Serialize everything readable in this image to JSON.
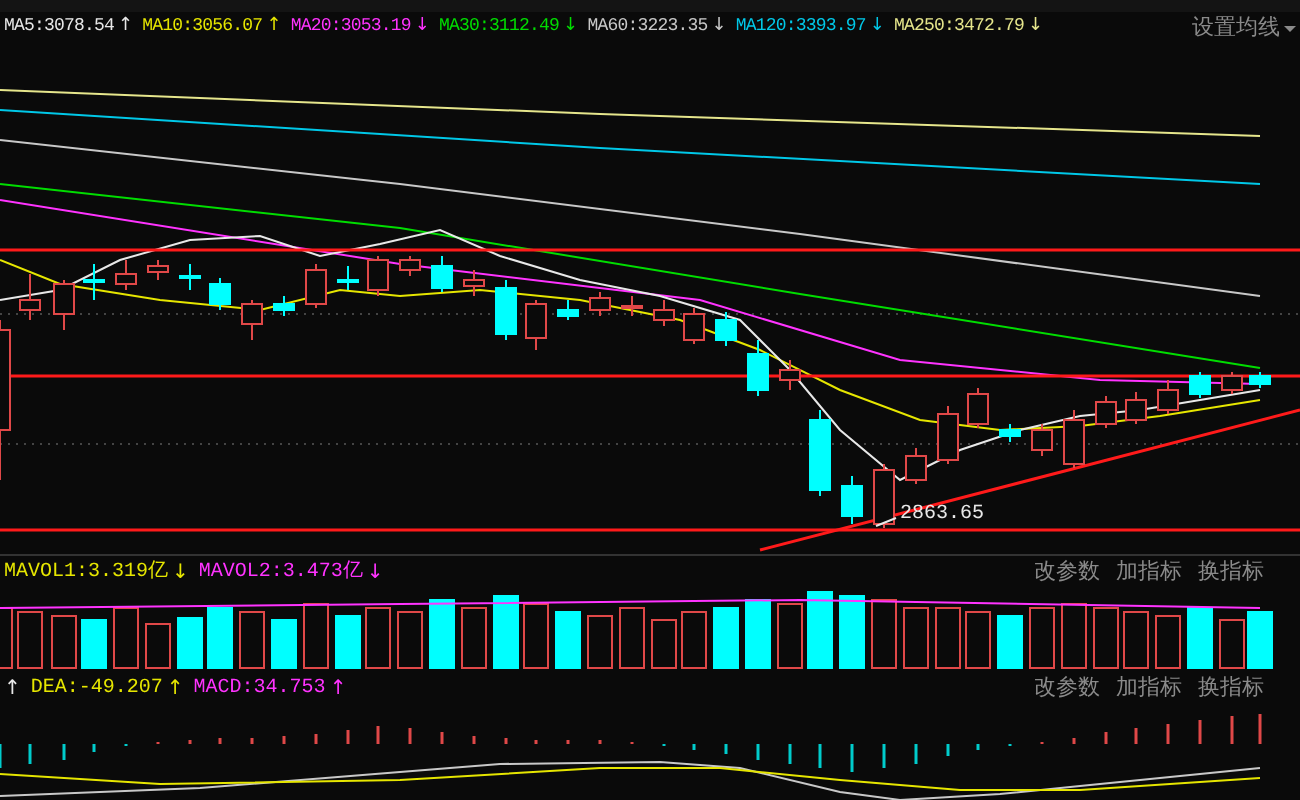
{
  "ma_legend": [
    {
      "label": "MA5:3078.54",
      "color": "#e8e8e8",
      "arrow": "↑"
    },
    {
      "label": "MA10:3056.07",
      "color": "#e6e600",
      "arrow": "↑"
    },
    {
      "label": "MA20:3053.19",
      "color": "#ff33ff",
      "arrow": "↓"
    },
    {
      "label": "MA30:3112.49",
      "color": "#00dd00",
      "arrow": "↓"
    },
    {
      "label": "MA60:3223.35",
      "color": "#c8c8c8",
      "arrow": "↓"
    },
    {
      "label": "MA120:3393.97",
      "color": "#00c8e8",
      "arrow": "↓"
    },
    {
      "label": "MA250:3472.79",
      "color": "#e6e68c",
      "arrow": "↓"
    }
  ],
  "ma_settings": {
    "label": "设置均线"
  },
  "price_chart": {
    "low_label": "2863.65"
  },
  "volume_panel": {
    "legend": [
      {
        "label": "MAVOL1:3.319亿",
        "color": "#e6e600",
        "arrow": "↓"
      },
      {
        "label": "MAVOL2:3.473亿",
        "color": "#ff33ff",
        "arrow": "↓"
      }
    ],
    "buttons": [
      "改参数",
      "加指标",
      "换指标"
    ]
  },
  "macd_panel": {
    "legend": [
      {
        "color": "#e8e8e8",
        "arrow": "↑"
      },
      {
        "label": "DEA:-49.207",
        "color": "#e6e600",
        "arrow": "↑"
      },
      {
        "label": "MACD:34.753",
        "color": "#ff33ff",
        "arrow": "↑"
      }
    ],
    "buttons": [
      "改参数",
      "加指标",
      "换指标"
    ]
  }
}
